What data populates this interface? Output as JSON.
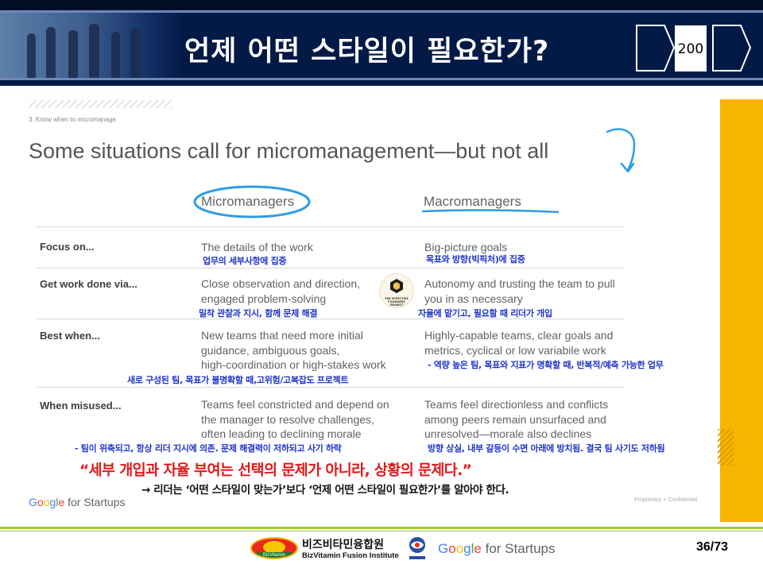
{
  "header": {
    "title": "언제 어떤 스타일이 필요한가?",
    "page_number": "200"
  },
  "slide": {
    "section_label": "3. Know when to micromanage",
    "headline": "Some situations call for micromanagement—but not all",
    "columns": {
      "micro": "Micromanagers",
      "macro": "Macromanagers"
    },
    "rows": [
      {
        "label": "Focus on...",
        "micro": [
          "The details of the work"
        ],
        "macro": [
          "Big-picture goals"
        ],
        "micro_kr": "업무의 세부사항에 집중",
        "macro_kr": "목표와 방향(빅픽처)에 집중"
      },
      {
        "label": "Get work done via...",
        "micro": [
          "Close observation and direction,",
          "engaged problem-solving"
        ],
        "macro": [
          "Autonomy and trusting the team to pull",
          "you in as necessary"
        ],
        "micro_kr": "밀착 관찰과 지시, 함께 문제 해결",
        "macro_kr": "자율에 맡기고, 필요할 때 리더가 개입"
      },
      {
        "label": "Best when...",
        "micro": [
          "New teams that need more initial",
          "guidance, ambiguous goals,",
          "high-coordination or high-stakes work"
        ],
        "macro": [
          "Highly-capable teams, clear goals and",
          "metrics, cyclical or low variabile work"
        ],
        "micro_kr": "새로 구성된 팀, 목표가 불명확할 때,고위험/고복잡도 프로젝트",
        "macro_kr": "- 역량 높은 팀, 목표와 지표가 명확할 때, 반복적/예측 가능한 업무"
      },
      {
        "label": "When misused...",
        "micro": [
          "Teams feel constricted and depend on",
          "the manager to resolve challenges,",
          "often leading to declining morale"
        ],
        "macro": [
          "Teams feel directionless and conflicts",
          "among peers remain unsurfaced and",
          "unresolved—morale also declines"
        ],
        "micro_kr": "- 팀이 위축되고, 항상 리더 지시에 의존. 문제 해결력이 저하되고 사기 하락",
        "macro_kr": "방향 상실, 내부 갈등이 수면 아래에 방치됨. 결국 팀 사기도 저하됨"
      }
    ],
    "badge_text": "THE EFFECTIVE FOUNDERS PROJECT",
    "quote": "“세부 개입과 자율 부여는 선택의 문제가 아니라, 상황의 문제다.”",
    "quote_sub": "→ 리더는 ‘어떤 스타일이 맞는가’보다 ‘언제 어떤 스타일이 필요한가’를 알아야 한다.",
    "brand": {
      "g1": "G",
      "g2": "o",
      "g3": "o",
      "g4": "g",
      "g5": "l",
      "g6": "e",
      "rest": " for Startups"
    },
    "confidential": "Proprietary + Confidential"
  },
  "footer": {
    "org_name": "비즈비타민융합원",
    "org_name_en": "BizVitamin Fusion Institute",
    "logo_caption": "BizVitamin",
    "page_counter": "36/73"
  },
  "colors": {
    "header_bg": "#031a47",
    "accent_yellow": "#f7b500",
    "korean_note": "#1f35c8",
    "quote_red": "#e0191a",
    "footer_green": "#9acd32"
  }
}
